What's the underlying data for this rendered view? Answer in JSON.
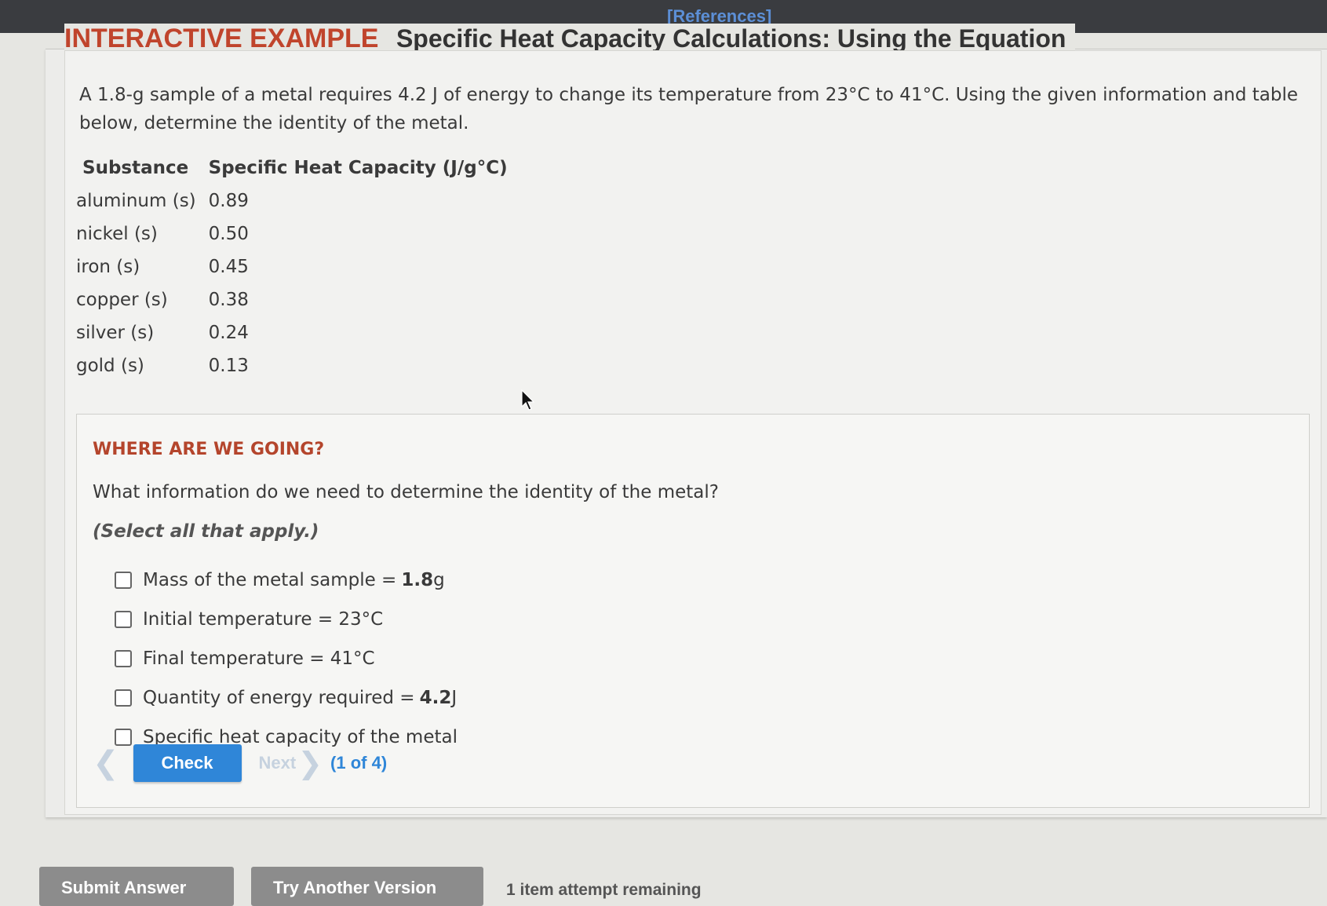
{
  "topbar": {
    "references_label": "[References]"
  },
  "header": {
    "interactive_label": "INTERACTIVE EXAMPLE",
    "title": "Specific Heat Capacity Calculations: Using the Equation"
  },
  "problem": {
    "text": "A 1.8-g sample of a metal requires 4.2 J of energy to change its temperature from 23°C to 41°C. Using the given information and table below, determine the identity of the metal."
  },
  "table": {
    "headers": [
      "Substance",
      "Specific Heat Capacity (J/g°C)"
    ],
    "rows": [
      {
        "substance": "aluminum (s)",
        "value": "0.89"
      },
      {
        "substance": "nickel (s)",
        "value": "0.50"
      },
      {
        "substance": "iron (s)",
        "value": "0.45"
      },
      {
        "substance": "copper (s)",
        "value": "0.38"
      },
      {
        "substance": "silver (s)",
        "value": "0.24"
      },
      {
        "substance": "gold (s)",
        "value": "0.13"
      }
    ]
  },
  "guide": {
    "heading": "WHERE ARE WE GOING?",
    "question": "What information do we need to determine the identity of the metal?",
    "instruction": "(Select all that apply.)",
    "options": [
      {
        "label": "Mass of the metal sample =",
        "value": "1.8",
        "unit": " g",
        "checked": false
      },
      {
        "label": "Initial temperature = 23°C",
        "value": "",
        "unit": "",
        "checked": false
      },
      {
        "label": "Final temperature = 41°C",
        "value": "",
        "unit": "",
        "checked": false
      },
      {
        "label": "Quantity of energy required =",
        "value": "4.2",
        "unit": " J",
        "checked": false
      },
      {
        "label": "Specific heat capacity of the metal",
        "value": "",
        "unit": "",
        "checked": false
      }
    ],
    "check_label": "Check",
    "next_label": "Next",
    "progress": "(1 of 4)"
  },
  "footer": {
    "submit_label": "Submit Answer",
    "try_label": "Try Another Version",
    "attempts": "1 item attempt remaining"
  },
  "colors": {
    "accent_blue": "#2f86d8",
    "heading_red": "#c0442c",
    "disabled_nav": "#c6d2df",
    "footer_button": "#8c8c8c"
  }
}
